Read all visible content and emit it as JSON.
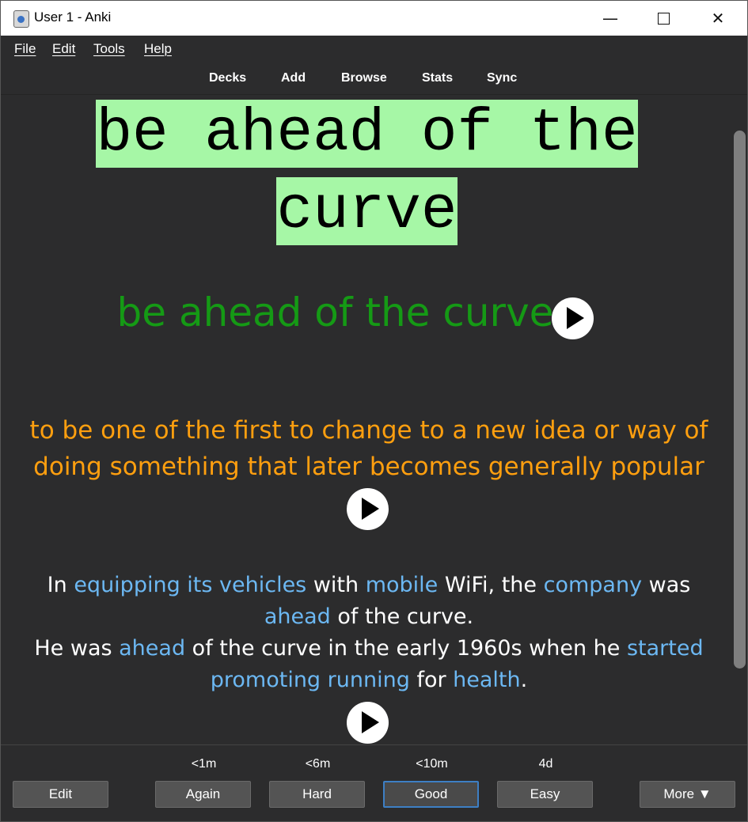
{
  "window": {
    "title": "User 1 - Anki"
  },
  "menu": {
    "file": "File",
    "edit": "Edit",
    "tools": "Tools",
    "help": "Help"
  },
  "toolbar": {
    "decks": "Decks",
    "add": "Add",
    "browse": "Browse",
    "stats": "Stats",
    "sync": "Sync"
  },
  "card": {
    "front_line1": "be ahead of the",
    "front_line2": "curve",
    "pronunciation": "be ahead of the curve",
    "definition": "to be one of the first to change to a new idea or way of doing something that later becomes generally popular",
    "example1": {
      "t1": "In ",
      "k1": "equipping its vehicles",
      "t2": " with ",
      "k2": "mobile",
      "t3": " WiFi, the ",
      "k3": "company",
      "t4": " was ",
      "k4": "ahead",
      "t5": " of the curve."
    },
    "example2": {
      "t1": "He was ",
      "k1": "ahead",
      "t2": " of the curve in the early 1960s when he ",
      "k2": "started",
      "k3": "promoting running",
      "t3": " for ",
      "k4": "health",
      "t4": "."
    }
  },
  "answer": {
    "edit": "Edit",
    "again": {
      "label": "Again",
      "due": "<1m"
    },
    "hard": {
      "label": "Hard",
      "due": "<6m"
    },
    "good": {
      "label": "Good",
      "due": "<10m"
    },
    "easy": {
      "label": "Easy",
      "due": "4d"
    },
    "more": "More ▼"
  },
  "icons": {
    "play": "play-icon",
    "app": "anki-icon"
  },
  "colors": {
    "front_highlight": "#a6f7a6",
    "pronunciation": "#159a15",
    "definition": "#ff9f0f",
    "keyword": "#6cb8f3",
    "background": "#2c2c2d"
  }
}
